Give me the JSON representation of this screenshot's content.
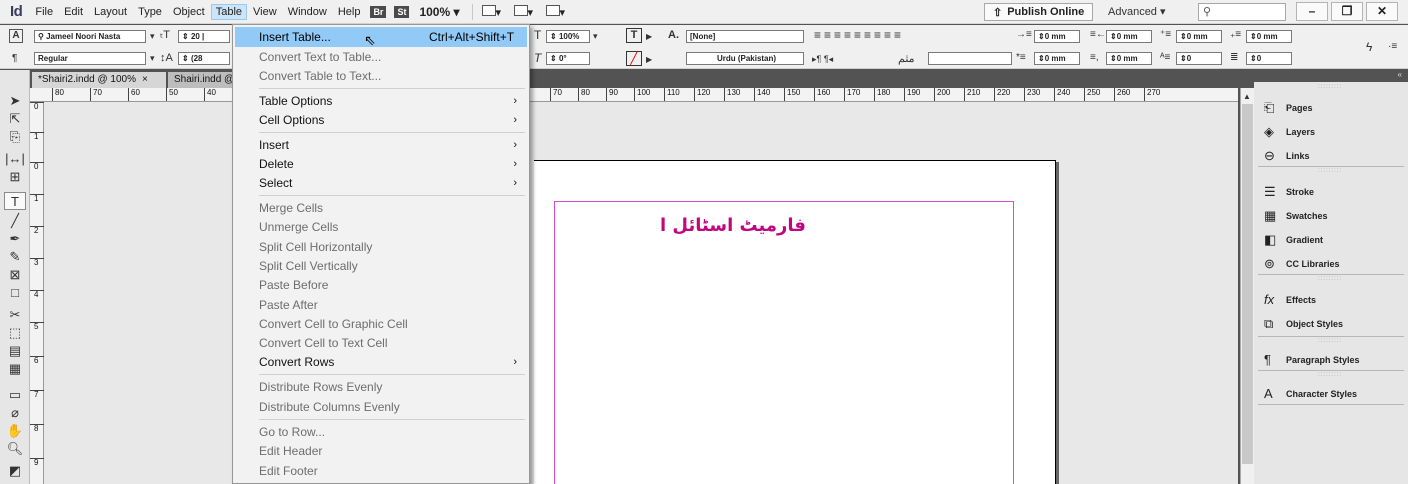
{
  "app": {
    "icon_label": "Id"
  },
  "menu": {
    "items": [
      "File",
      "Edit",
      "Layout",
      "Type",
      "Object",
      "Table",
      "View",
      "Window",
      "Help"
    ],
    "active": "Table",
    "bridge": "Br",
    "stock": "St",
    "zoom": "100% ▾",
    "publish": "Publish Online",
    "workspace": "Advanced ▾",
    "search_placeholder": ""
  },
  "control": {
    "font_family": "Jameel Noori Nasta",
    "font_style": "Regular",
    "font_size": "20 |",
    "leading": "(28",
    "scale_pct": "100%",
    "skew": "0°",
    "char_style": "[None]",
    "language": "Urdu (Pakistan)",
    "margin_a": "0 mm",
    "margin_b": "0 mm",
    "margin_c": "0 mm",
    "margin_d": "0 mm",
    "space_a": "0 mm",
    "space_b": "0",
    "space_c": "0 mm",
    "space_d": "0"
  },
  "tabs": {
    "doc1": "*Shairi2.indd @ 100%",
    "doc2": "Shairi.indd @"
  },
  "ruler": {
    "left_ticks": [
      "80",
      "70",
      "60",
      "50",
      "40",
      "30"
    ],
    "right_ticks": [
      "70",
      "80",
      "90",
      "100",
      "110",
      "120",
      "130",
      "140",
      "150",
      "160",
      "170",
      "180",
      "190",
      "200",
      "210",
      "220",
      "230",
      "240",
      "250",
      "260",
      "270"
    ],
    "vertical": [
      "0",
      "1",
      "0",
      "1",
      "2",
      "3",
      "4",
      "5",
      "6",
      "7",
      "8",
      "9"
    ]
  },
  "page": {
    "urdu_text": "فارمیٹ اسٹائل ا"
  },
  "panels": {
    "group1": [
      "Pages",
      "Layers",
      "Links"
    ],
    "group2": [
      "Stroke",
      "Swatches",
      "Gradient",
      "CC Libraries"
    ],
    "group3": [
      "Effects",
      "Object Styles"
    ],
    "group4": [
      "Paragraph Styles"
    ],
    "group5": [
      "Character Styles"
    ]
  },
  "dropdown": {
    "insert_table": "Insert Table...",
    "insert_table_shortcut": "Ctrl+Alt+Shift+T",
    "convert_text_to_table": "Convert Text to Table...",
    "convert_table_to_text": "Convert Table to Text...",
    "table_options": "Table Options",
    "cell_options": "Cell Options",
    "insert": "Insert",
    "delete": "Delete",
    "select": "Select",
    "merge_cells": "Merge Cells",
    "unmerge_cells": "Unmerge Cells",
    "split_h": "Split Cell Horizontally",
    "split_v": "Split Cell Vertically",
    "paste_before": "Paste Before",
    "paste_after": "Paste After",
    "to_graphic": "Convert Cell to Graphic Cell",
    "to_text": "Convert Cell to Text Cell",
    "convert_rows": "Convert Rows",
    "dist_rows": "Distribute Rows Evenly",
    "dist_cols": "Distribute Columns Evenly",
    "go_to_row": "Go to Row...",
    "edit_header": "Edit Header",
    "edit_footer": "Edit Footer"
  }
}
